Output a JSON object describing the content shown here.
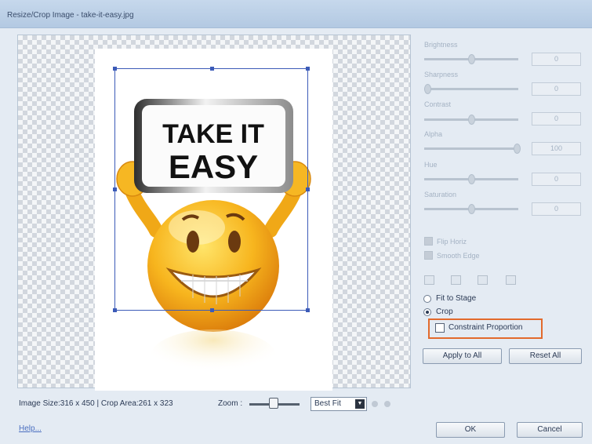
{
  "window": {
    "title": "Resize/Crop Image - take-it-easy.jpg"
  },
  "image": {
    "sign_line1": "TAKE IT",
    "sign_line2": "EASY"
  },
  "footer": {
    "image_size_label": "Image Size:316 x 450 | Crop Area:261 x 323",
    "zoom_label": "Zoom :",
    "zoom_select": "Best Fit",
    "help_link": "Help..."
  },
  "adjustments": [
    {
      "label": "Brightness",
      "value": "0",
      "level": 0.5
    },
    {
      "label": "Sharpness",
      "value": "0",
      "level": 0.0
    },
    {
      "label": "Contrast",
      "value": "0",
      "level": 0.5
    },
    {
      "label": "Alpha",
      "value": "100",
      "level": 1.0
    },
    {
      "label": "Hue",
      "value": "0",
      "level": 0.5
    },
    {
      "label": "Saturation",
      "value": "0",
      "level": 0.5
    }
  ],
  "options": {
    "check_1": "Flip Horiz",
    "check_2": "Smooth Edge"
  },
  "tools": [
    "rotate-left-icon",
    "rotate-right-icon",
    "flip-icon",
    "reset-icon"
  ],
  "mode": {
    "fit_to_stage": "Fit to Stage",
    "crop": "Crop",
    "constraint_proportion": "Constraint Proportion"
  },
  "buttons": {
    "apply_to_all": "Apply to All",
    "reset_all": "Reset All",
    "ok": "OK",
    "cancel": "Cancel"
  },
  "colors": {
    "highlight": "#e26a2c",
    "crop_frame": "#3c5bb8",
    "link": "#4b6fc0"
  }
}
